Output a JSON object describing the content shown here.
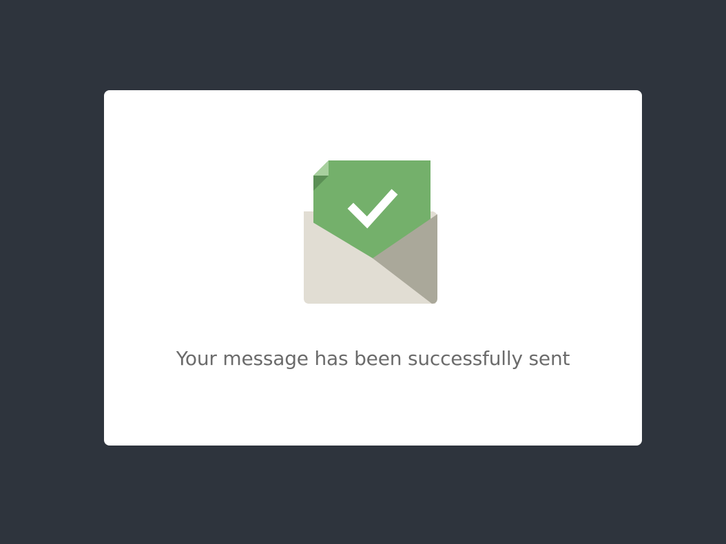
{
  "dialog": {
    "message": "Your message has been successfully sent",
    "icon": "envelope-check-icon"
  },
  "colors": {
    "background": "#2e343d",
    "card": "#ffffff",
    "envelope_light": "#e1ddd3",
    "envelope_dark": "#aaa89a",
    "letter_green": "#74b06b",
    "letter_fold": "#5b8f55",
    "letter_fold_light": "#a8d09e",
    "message_text": "#6b6b6b"
  }
}
